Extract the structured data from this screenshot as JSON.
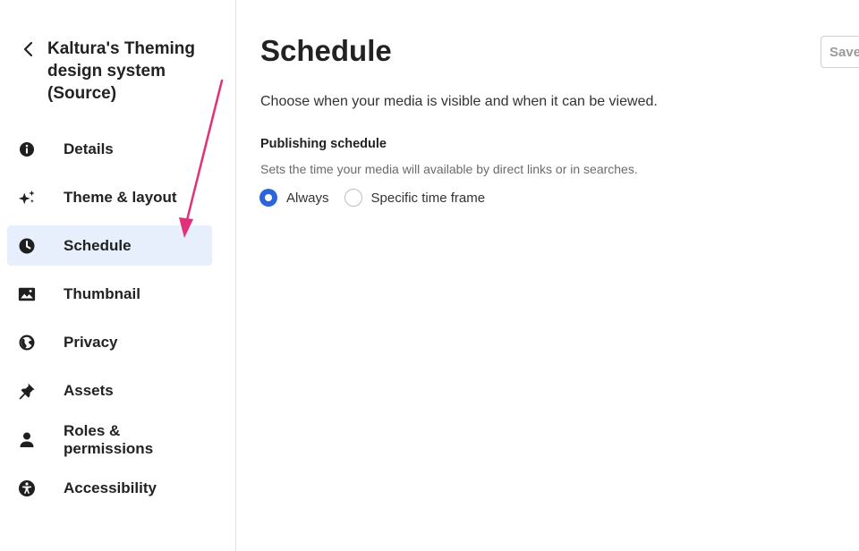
{
  "sidebar": {
    "back_icon": "chevron-left-icon",
    "media_title": "Kaltura's Theming design system (Source)",
    "items": [
      {
        "label": "Details",
        "icon": "info-icon",
        "active": false
      },
      {
        "label": "Theme & layout",
        "icon": "sparkles-icon",
        "active": false
      },
      {
        "label": "Schedule",
        "icon": "clock-icon",
        "active": true
      },
      {
        "label": "Thumbnail",
        "icon": "image-icon",
        "active": false
      },
      {
        "label": "Privacy",
        "icon": "globe-icon",
        "active": false
      },
      {
        "label": "Assets",
        "icon": "pin-icon",
        "active": false
      },
      {
        "label": "Roles & permissions",
        "icon": "user-icon",
        "active": false
      },
      {
        "label": "Accessibility",
        "icon": "accessibility-icon",
        "active": false
      }
    ]
  },
  "main": {
    "title": "Schedule",
    "save_label": "Save",
    "intro": "Choose when your media is visible and when it can be viewed.",
    "section_title": "Publishing schedule",
    "section_desc": "Sets the time your media will available by direct links or in searches.",
    "radio_options": [
      {
        "label": "Always",
        "checked": true
      },
      {
        "label": "Specific time frame",
        "checked": false
      }
    ]
  },
  "colors": {
    "accent": "#2b65d9",
    "active_bg": "#e8effc",
    "annotation": "#e0307a"
  }
}
